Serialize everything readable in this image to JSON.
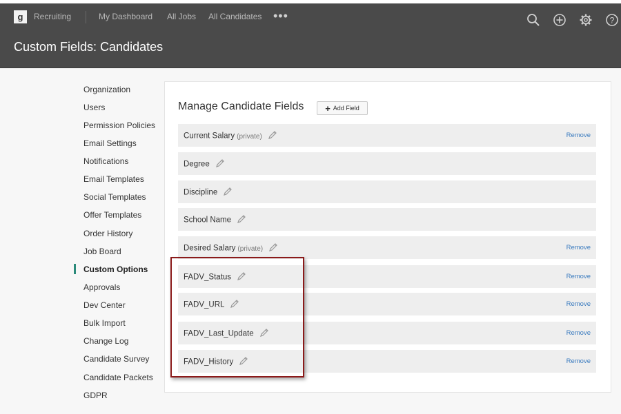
{
  "app": {
    "logo_text": "g",
    "product": "Recruiting",
    "nav": [
      "My Dashboard",
      "All Jobs",
      "All Candidates"
    ],
    "more": "•••",
    "icons": [
      "search-icon",
      "plus-circle-icon",
      "gear-icon",
      "help-icon"
    ]
  },
  "page": {
    "title": "Custom Fields: Candidates"
  },
  "sidebar": {
    "items": [
      {
        "label": "Organization"
      },
      {
        "label": "Users"
      },
      {
        "label": "Permission Policies"
      },
      {
        "label": "Email Settings"
      },
      {
        "label": "Notifications"
      },
      {
        "label": "Email Templates"
      },
      {
        "label": "Social Templates"
      },
      {
        "label": "Offer Templates"
      },
      {
        "label": "Order History"
      },
      {
        "label": "Job Board"
      },
      {
        "label": "Custom Options",
        "active": true
      },
      {
        "label": "Approvals"
      },
      {
        "label": "Dev Center"
      },
      {
        "label": "Bulk Import"
      },
      {
        "label": "Change Log"
      },
      {
        "label": "Candidate Survey"
      },
      {
        "label": "Candidate Packets"
      },
      {
        "label": "GDPR"
      }
    ]
  },
  "main": {
    "title": "Manage Candidate Fields",
    "add_button": "Add Field",
    "remove_label": "Remove",
    "fields": [
      {
        "name": "Current Salary",
        "private": "(private)",
        "removable": true
      },
      {
        "name": "Degree",
        "private": "",
        "removable": false
      },
      {
        "name": "Discipline",
        "private": "",
        "removable": false
      },
      {
        "name": "School Name",
        "private": "",
        "removable": false
      },
      {
        "name": "Desired Salary",
        "private": "(private)",
        "removable": true
      },
      {
        "name": "FADV_Status",
        "private": "",
        "removable": true
      },
      {
        "name": "FADV_URL",
        "private": "",
        "removable": true
      },
      {
        "name": "FADV_Last_Update",
        "private": "",
        "removable": true
      },
      {
        "name": "FADV_History",
        "private": "",
        "removable": true
      }
    ]
  },
  "colors": {
    "header": "#4a4a4a",
    "accent": "#2b8a7a",
    "link": "#3a7bbf",
    "highlight": "#8b1a1a"
  }
}
